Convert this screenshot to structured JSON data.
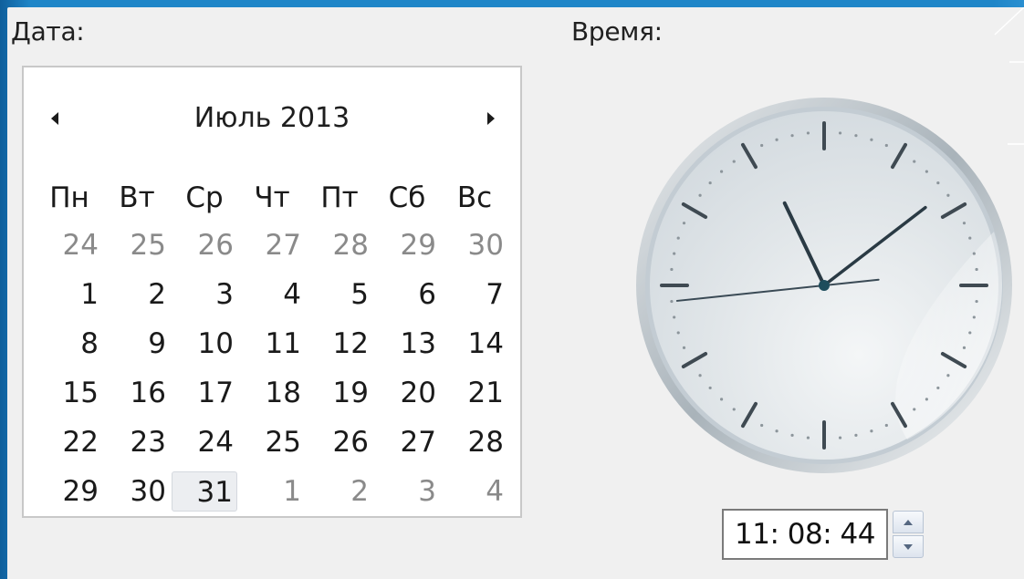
{
  "labels": {
    "date": "Дата:",
    "time": "Время:"
  },
  "calendar": {
    "title": "Июль 2013",
    "weekdays": [
      "Пн",
      "Вт",
      "Ср",
      "Чт",
      "Пт",
      "Сб",
      "Вс"
    ],
    "weeks": [
      [
        {
          "d": "24",
          "other": true
        },
        {
          "d": "25",
          "other": true
        },
        {
          "d": "26",
          "other": true
        },
        {
          "d": "27",
          "other": true
        },
        {
          "d": "28",
          "other": true
        },
        {
          "d": "29",
          "other": true
        },
        {
          "d": "30",
          "other": true
        }
      ],
      [
        {
          "d": "1"
        },
        {
          "d": "2"
        },
        {
          "d": "3"
        },
        {
          "d": "4"
        },
        {
          "d": "5"
        },
        {
          "d": "6"
        },
        {
          "d": "7"
        }
      ],
      [
        {
          "d": "8"
        },
        {
          "d": "9"
        },
        {
          "d": "10"
        },
        {
          "d": "11"
        },
        {
          "d": "12"
        },
        {
          "d": "13"
        },
        {
          "d": "14"
        }
      ],
      [
        {
          "d": "15"
        },
        {
          "d": "16"
        },
        {
          "d": "17"
        },
        {
          "d": "18"
        },
        {
          "d": "19"
        },
        {
          "d": "20"
        },
        {
          "d": "21"
        }
      ],
      [
        {
          "d": "22"
        },
        {
          "d": "23"
        },
        {
          "d": "24"
        },
        {
          "d": "25"
        },
        {
          "d": "26"
        },
        {
          "d": "27"
        },
        {
          "d": "28"
        }
      ],
      [
        {
          "d": "29"
        },
        {
          "d": "30"
        },
        {
          "d": "31",
          "today": true
        },
        {
          "d": "1",
          "other": true
        },
        {
          "d": "2",
          "other": true
        },
        {
          "d": "3",
          "other": true
        },
        {
          "d": "4",
          "other": true
        }
      ]
    ],
    "icons": {
      "prev": "triangle-left-icon",
      "next": "triangle-right-icon"
    }
  },
  "clock": {
    "hours": 11,
    "minutes": 8,
    "seconds": 44
  },
  "time_field": {
    "value": "11: 08: 44"
  },
  "colors": {
    "background": "#1a78b8",
    "panel": "#f0f0f0",
    "other_month_text": "#8a8a8a",
    "today_highlight": "#eceef1"
  }
}
